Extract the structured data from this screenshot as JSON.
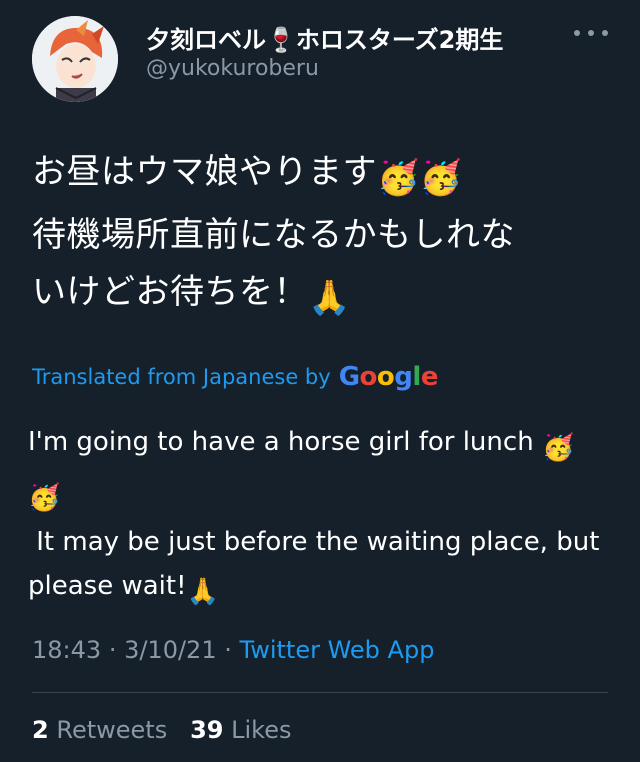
{
  "user": {
    "display_name": "夕刻ロベル🍷ホロスターズ2期生",
    "handle": "@yukokuroberu"
  },
  "tweet": {
    "text_line1": "お昼はウマ娘やります",
    "text_line2": "待機場所直前になるかもしれな",
    "text_line3": "いけどお待ちを！",
    "emoji_party": "🥳",
    "emoji_pray": "🙏"
  },
  "translation": {
    "label": "Translated from Japanese by",
    "provider": "Google",
    "line1": "I'm going to have a horse girl for lunch ",
    "line3": " It may be just before the waiting place, but",
    "line4": "please wait!"
  },
  "meta": {
    "time": "18:43",
    "date": "3/10/21",
    "source": "Twitter Web App"
  },
  "stats": {
    "retweets_count": "2",
    "retweets_label": "Retweets",
    "likes_count": "39",
    "likes_label": "Likes"
  }
}
